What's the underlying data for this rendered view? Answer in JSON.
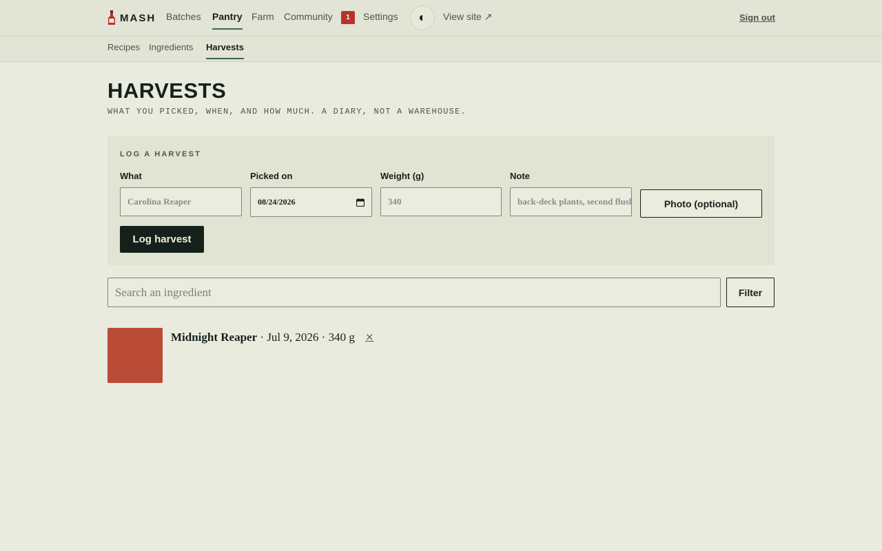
{
  "nav": {
    "brand": "MASH",
    "links": [
      "Batches",
      "Pantry",
      "Farm",
      "Community",
      "Settings"
    ],
    "active": "Pantry",
    "community_badge": "1",
    "view_site": "View site ↗",
    "sign_out": "Sign out"
  },
  "subnav": {
    "links": [
      "Recipes",
      "Ingredients",
      "Harvests"
    ],
    "active": "Harvests"
  },
  "page": {
    "title": "HARVESTS",
    "subtitle": "WHAT YOU PICKED, WHEN, AND HOW MUCH. A DIARY, NOT A WAREHOUSE."
  },
  "form": {
    "title": "LOG A HARVEST",
    "what_label": "What",
    "what_placeholder": "Carolina Reaper",
    "date_label": "Picked on",
    "date_value": "08/24/2026",
    "weight_label": "Weight (g)",
    "weight_placeholder": "340",
    "note_label": "Note",
    "note_placeholder": "back-deck plants, second flush",
    "photo_button": "Photo (optional)",
    "submit_button": "Log harvest"
  },
  "search": {
    "placeholder": "Search an ingredient",
    "filter_button": "Filter"
  },
  "harvests": [
    {
      "name": "Midnight Reaper",
      "date": "Jul 9, 2026",
      "weight": "340 g",
      "remove": "×",
      "thumb_color": "#b94a36"
    }
  ],
  "colors": {
    "background": "#e9ebdf",
    "bar": "#e2e4d5",
    "ink": "#16201a",
    "accent": "#3a6a48",
    "badge": "#b8322a"
  }
}
